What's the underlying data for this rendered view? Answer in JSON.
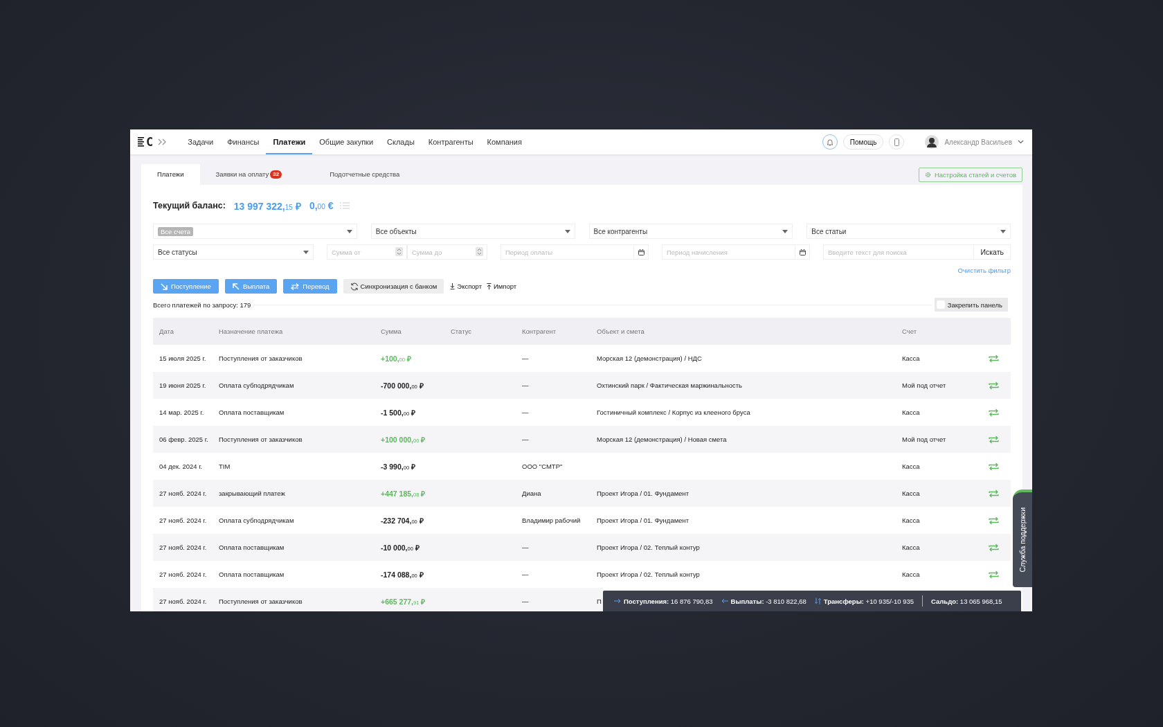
{
  "nav": {
    "logo": "C",
    "items": [
      {
        "label": "Задачи",
        "selected": false
      },
      {
        "label": "Финансы",
        "selected": false
      },
      {
        "label": "Платежи",
        "selected": true
      },
      {
        "label": "Общие закупки",
        "selected": false
      },
      {
        "label": "Склады",
        "selected": false
      },
      {
        "label": "Контрагенты",
        "selected": false
      },
      {
        "label": "Компания",
        "selected": false
      }
    ],
    "help": "Помощь",
    "user": "Александр Васильев"
  },
  "tabs": [
    {
      "label": "Платежи",
      "selected": true
    },
    {
      "label": "Заявки на оплату",
      "badge": "32",
      "selected": false
    },
    {
      "label": "Подотчетные средства",
      "selected": false
    }
  ],
  "settings_button": "Настройка статей и счетов",
  "balance": {
    "label": "Текущий баланс:",
    "values": [
      "13 997 322,$_{15}$ ₽",
      "0,$_{00}$ €"
    ]
  },
  "filters_row_1": [
    {
      "kind": "chip",
      "value": "Все счета"
    },
    {
      "kind": "select",
      "value": "Все объекты"
    },
    {
      "kind": "select",
      "value": "Все контрагенты"
    },
    {
      "kind": "select",
      "value": "Все статьи"
    }
  ],
  "filters_row_2": [
    {
      "kind": "select",
      "value": "Все статусы"
    },
    {
      "kind": "number",
      "placeholder": "Сумма от"
    },
    {
      "kind": "number",
      "placeholder": "Сумма до"
    },
    {
      "kind": "date",
      "placeholder": "Период оплаты"
    },
    {
      "kind": "date",
      "placeholder": "Период начисления"
    },
    {
      "kind": "search",
      "placeholder": "Введите текст для поиска",
      "button": "Искать"
    }
  ],
  "clear_filter": "Очистить фильтр",
  "actions": [
    {
      "kind": "in",
      "label": "Поступление"
    },
    {
      "kind": "out",
      "label": "Выплата"
    },
    {
      "kind": "transfer",
      "label": "Перевод"
    },
    {
      "kind": "sync",
      "label": "Синхронизация с банком"
    },
    {
      "kind": "export",
      "label": "Экспорт"
    },
    {
      "kind": "import",
      "label": "Импорт"
    }
  ],
  "total": "Всего платежей по запросу: 179",
  "pin_panel": {
    "label": "Закрепить панель",
    "checked": false
  },
  "table": {
    "columns": [
      "Дата",
      "Назначение платежа",
      "Сумма",
      "Статус",
      "Контрагент",
      "Объект и смета",
      "Счет"
    ],
    "rows": [
      {
        "date": "15 июля 2025 г.",
        "purpose": "Поступления от заказчиков",
        "amount": "+100,$_{00}$ ₽",
        "kind": "income",
        "counterparty": "—",
        "object": "Морская 12 (демонстрация) / НДС",
        "account": "Касса"
      },
      {
        "date": "19 июня 2025 г.",
        "purpose": "Оплата субподрядчикам",
        "amount": "-700 000,$_{00}$ ₽",
        "kind": "expense",
        "counterparty": "—",
        "object": "Охтинский парк / Фактическая маржинальность",
        "account": "Мой под отчет"
      },
      {
        "date": "14 мар. 2025 г.",
        "purpose": "Оплата поставщикам",
        "amount": "-1 500,$_{00}$ ₽",
        "kind": "expense",
        "counterparty": "—",
        "object": "Гостиничный комплекс / Корпус из клееного бруса",
        "account": "Касса"
      },
      {
        "date": "06 февр. 2025 г.",
        "purpose": "Поступления от заказчиков",
        "amount": "+100 000,$_{00}$ ₽",
        "kind": "income",
        "counterparty": "—",
        "object": "Морская 12 (демонстрация) / Новая смета",
        "account": "Мой под отчет"
      },
      {
        "date": "04 дек. 2024 г.",
        "purpose": "TIM",
        "amount": "-3 990,$_{00}$ ₽",
        "kind": "expense",
        "counterparty": "ООО \"СМТР\"",
        "account": "Касса"
      },
      {
        "date": "27 нояб. 2024 г.",
        "purpose": "закрывающий платеж",
        "amount": "+447 185,$_{08}$ ₽",
        "kind": "income",
        "counterparty": "Диана",
        "object": "Проект Игора / 01. Фундамент",
        "account": "Касса"
      },
      {
        "date": "27 нояб. 2024 г.",
        "purpose": "Оплата субподрядчикам",
        "amount": "-232 704,$_{00}$ ₽",
        "kind": "expense",
        "counterparty": "Владимир рабочий",
        "object": "Проект Игора / 01. Фундамент",
        "account": "Касса"
      },
      {
        "date": "27 нояб. 2024 г.",
        "purpose": "Оплата поставщикам",
        "amount": "-10 000,$_{00}$ ₽",
        "kind": "expense",
        "counterparty": "—",
        "object": "Проект Игора / 02. Теплый контур",
        "account": "Касса"
      },
      {
        "date": "27 нояб. 2024 г.",
        "purpose": "Оплата поставщикам",
        "amount": "-174 088,$_{00}$ ₽",
        "kind": "expense",
        "counterparty": "—",
        "object": "Проект Игора / 02. Теплый контур",
        "account": "Касса"
      },
      {
        "date": "27 нояб. 2024 г.",
        "purpose": "Поступления от заказчиков",
        "amount": "+665 277,$_{91}$ ₽",
        "kind": "income",
        "counterparty": "—",
        "object": "П"
      }
    ]
  },
  "summary": {
    "items": [
      {
        "kind": "in",
        "label": "Поступления:",
        "value": "16 876 790,83"
      },
      {
        "kind": "out",
        "label": "Выплаты:",
        "value": "-3 810 822,68"
      },
      {
        "kind": "transfer",
        "label": "Трансферы:",
        "value": "+10 935/-10 935"
      }
    ],
    "saldo": {
      "label": "Сальдо:",
      "value": "13 065 968,15"
    }
  },
  "support_tab": "Служба поддержки"
}
